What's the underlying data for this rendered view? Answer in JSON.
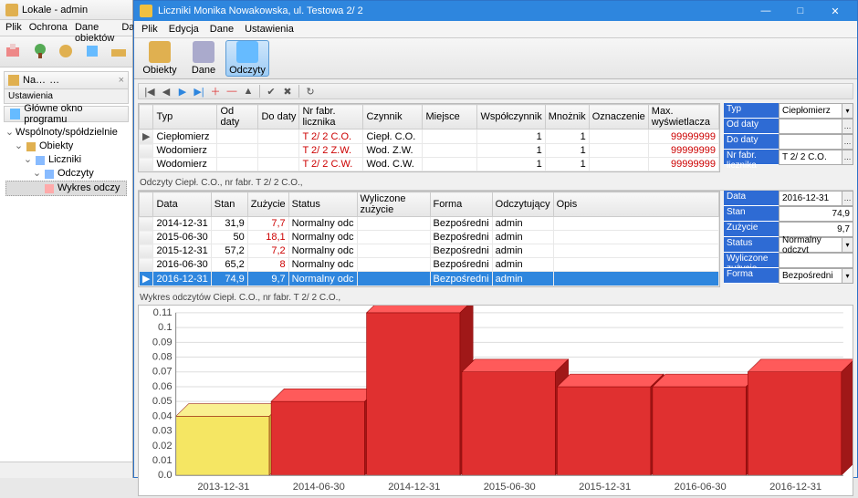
{
  "bg": {
    "title": "Lokale - admin",
    "menu": [
      "Plik",
      "Ochrona",
      "Dane obiektów",
      "Dane"
    ],
    "nav_title": "Na…",
    "nav_sub": "Ustawienia",
    "nav_btn": "Główne okno programu",
    "tree": {
      "n0": "Wspólnoty/spółdzielnie",
      "n1": "Obiekty",
      "n2": "Liczniki",
      "n3": "Odczyty",
      "n4": "Wykres odczy"
    }
  },
  "fg": {
    "title": "Liczniki Monika Nowakowska, ul. Testowa 2/ 2",
    "menu": [
      "Plik",
      "Edycja",
      "Dane",
      "Ustawienia"
    ],
    "ribbon": {
      "obiekty": "Obiekty",
      "dane": "Dane",
      "odczyty": "Odczyty"
    },
    "grid1": {
      "headers": [
        "Typ",
        "Od daty",
        "Do daty",
        "Nr fabr. licznika",
        "Czynnik",
        "Miejsce",
        "Współczynnik",
        "Mnożnik",
        "Oznaczenie",
        "Max. wyświetlacza"
      ],
      "rows": [
        {
          "typ": "Ciepłomierz",
          "od": "",
          "do": "",
          "nr": "T 2/ 2 C.O.",
          "cz": "Ciepł. C.O.",
          "mi": "",
          "ws": "1",
          "mn": "1",
          "oz": "",
          "mx": "99999999"
        },
        {
          "typ": "Wodomierz",
          "od": "",
          "do": "",
          "nr": "T 2/ 2 Z.W.",
          "cz": "Wod. Z.W.",
          "mi": "",
          "ws": "1",
          "mn": "1",
          "oz": "",
          "mx": "99999999"
        },
        {
          "typ": "Wodomierz",
          "od": "",
          "do": "",
          "nr": "T 2/ 2 C.W.",
          "cz": "Wod. C.W.",
          "mi": "",
          "ws": "1",
          "mn": "1",
          "oz": "",
          "mx": "99999999"
        }
      ]
    },
    "side1": {
      "typ_l": "Typ",
      "typ_v": "Ciepłomierz",
      "od_l": "Od daty",
      "od_v": "",
      "do_l": "Do daty",
      "do_v": "",
      "nr_l": "Nr fabr. licznika",
      "nr_v": "T 2/ 2 C.O."
    },
    "odczyty_label": "Odczyty Ciepł. C.O., nr fabr. T 2/ 2 C.O.,",
    "grid2": {
      "headers": [
        "Data",
        "Stan",
        "Zużycie",
        "Status",
        "Wyliczone zużycie",
        "Forma",
        "Odczytujący",
        "Opis"
      ],
      "rows": [
        {
          "d": "2014-12-31",
          "s": "31,9",
          "z": "7,7",
          "st": "Normalny odc",
          "w": "",
          "f": "Bezpośredni",
          "o": "admin",
          "op": ""
        },
        {
          "d": "2015-06-30",
          "s": "50",
          "z": "18,1",
          "st": "Normalny odc",
          "w": "",
          "f": "Bezpośredni",
          "o": "admin",
          "op": ""
        },
        {
          "d": "2015-12-31",
          "s": "57,2",
          "z": "7,2",
          "st": "Normalny odc",
          "w": "",
          "f": "Bezpośredni",
          "o": "admin",
          "op": ""
        },
        {
          "d": "2016-06-30",
          "s": "65,2",
          "z": "8",
          "st": "Normalny odc",
          "w": "",
          "f": "Bezpośredni",
          "o": "admin",
          "op": ""
        },
        {
          "d": "2016-12-31",
          "s": "74,9",
          "z": "9,7",
          "st": "Normalny odc",
          "w": "",
          "f": "Bezpośredni",
          "o": "admin",
          "op": ""
        }
      ]
    },
    "side2": {
      "data_l": "Data",
      "data_v": "2016-12-31",
      "stan_l": "Stan",
      "stan_v": "74,9",
      "zuz_l": "Zużycie",
      "zuz_v": "9,7",
      "stat_l": "Status",
      "stat_v": "Normalny odczyt",
      "wyl_l": "Wyliczone zużycie",
      "wyl_v": "",
      "for_l": "Forma",
      "for_v": "Bezpośredni"
    },
    "wykres_label": "Wykres odczytów Ciepł. C.O., nr fabr. T 2/ 2 C.O.,"
  },
  "chart_data": {
    "type": "bar",
    "categories": [
      "2013-12-31",
      "2014-06-30",
      "2014-12-31",
      "2015-06-30",
      "2015-12-31",
      "2016-06-30",
      "2016-12-31"
    ],
    "values": [
      0.04,
      0.05,
      0.11,
      0.07,
      0.06,
      0.06,
      0.07
    ],
    "highlight_index": 0,
    "ylim": [
      0,
      0.11
    ],
    "ytick_step": 0.01,
    "ylabel": "",
    "xlabel": "",
    "title": ""
  }
}
